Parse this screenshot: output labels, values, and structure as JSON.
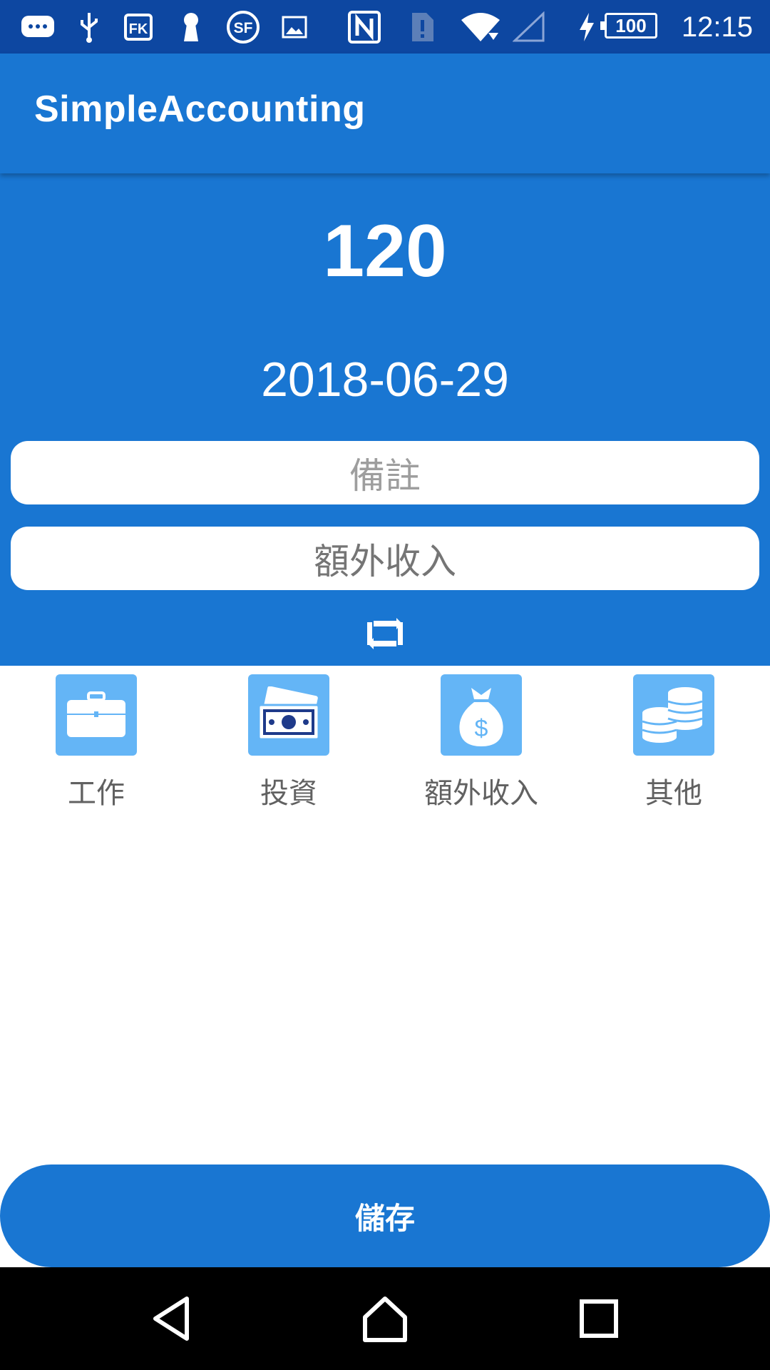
{
  "status_bar": {
    "time": "12:15",
    "battery": "100",
    "icons": [
      "chat-icon",
      "usb-icon",
      "app-fk-icon",
      "keyhole-icon",
      "sf-icon",
      "image-icon",
      "nfc-icon",
      "sim-icon",
      "wifi-icon",
      "signal-icon",
      "charging-icon"
    ]
  },
  "app_bar": {
    "title": "SimpleAccounting"
  },
  "entry": {
    "amount": "120",
    "date": "2018-06-29",
    "note_placeholder": "備註",
    "category_value": "額外收入"
  },
  "categories": [
    {
      "label": "工作",
      "icon": "briefcase-icon"
    },
    {
      "label": "投資",
      "icon": "cash-icon"
    },
    {
      "label": "額外收入",
      "icon": "money-bag-icon"
    },
    {
      "label": "其他",
      "icon": "coins-icon"
    }
  ],
  "actions": {
    "save_label": "儲存"
  },
  "colors": {
    "primary": "#1976d2",
    "status_bar": "#0d47a1",
    "tile": "#64b5f6",
    "text_gray": "#616161"
  }
}
